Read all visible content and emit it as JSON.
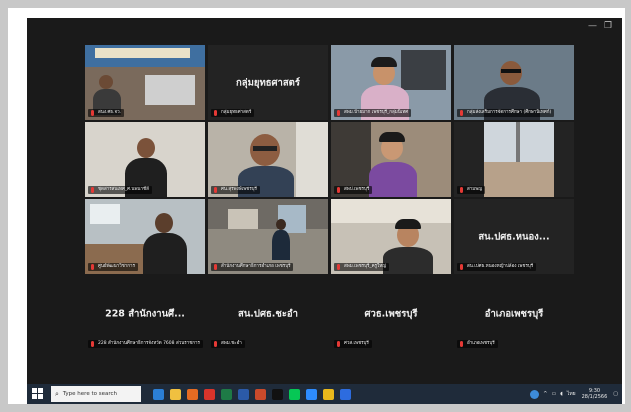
{
  "window": {
    "minimize_glyph": "—",
    "restore_glyph": "❐"
  },
  "tiles": [
    {
      "id": "t1",
      "name": "สนง.ศธ.จว.",
      "center": "",
      "active": true
    },
    {
      "id": "t2",
      "name": "กลุ่มยุทธศาสตร์",
      "center": "กลุ่มยุทธศาสตร์",
      "active": false
    },
    {
      "id": "t3",
      "name": "สพม.ป้ายมาก เพชรบุรี_กลุ่มนิเทศ",
      "center": "",
      "active": false
    },
    {
      "id": "t4",
      "name": "กลุ่มส่งเสริมการจัดการศึกษา (ศึกษานิเทศก์)",
      "center": "",
      "active": false
    },
    {
      "id": "t5",
      "name": "ชุดสารสนเทศ_ศ.นพนาชีลี",
      "center": "",
      "active": false
    },
    {
      "id": "t6",
      "name": "ศน.สุรพงษ์เพชรบุรี",
      "center": "",
      "active": false
    },
    {
      "id": "t7",
      "name": "สพป.เพชรบุรี",
      "center": "",
      "active": false
    },
    {
      "id": "t8",
      "name": "สามพญ",
      "center": "",
      "active": false
    },
    {
      "id": "t9",
      "name": "ศูนย์พัฒนาวิชาการ",
      "center": "",
      "active": false
    },
    {
      "id": "t10",
      "name": "สำนักงานศึกษาธิการอำเภอ เพชรบุรี",
      "center": "",
      "active": false
    },
    {
      "id": "t11",
      "name": "สพม.เพชรบุรี_ครูใหญ่",
      "center": "",
      "active": false
    },
    {
      "id": "t12",
      "name": "สน.เปศธ.หนองหญ้าปล้อง เพชรบุรี",
      "center": "สน.ปศธ.หนอง...",
      "active": false
    }
  ],
  "bottom_row": [
    {
      "id": "b1",
      "name": "228 สำนักงานศึกษาธิการจังหวัด 7608 ส่วนราชการ",
      "center": "228 สำนักงานศึ..."
    },
    {
      "id": "b2",
      "name": "สพม.ชะอำ",
      "center": "สน.ปศธ.ชะอำ"
    },
    {
      "id": "b3",
      "name": "ศวส.เพชรบุรี",
      "center": "ศวธ.เพชรบุรี"
    },
    {
      "id": "b4",
      "name": "อำเภอเพชรบุรี",
      "center": "อำเภอเพชรบุรี"
    }
  ],
  "taskbar": {
    "search_placeholder": "Type here to search",
    "clock_time": "9:30",
    "clock_date": "28/1/2566",
    "tray_lang": "ไทย",
    "icons": [
      {
        "name": "edge-icon",
        "color": "#2b7fd6"
      },
      {
        "name": "file-explorer-icon",
        "color": "#f0c040"
      },
      {
        "name": "firefox-icon",
        "color": "#e56b22"
      },
      {
        "name": "pdf-icon",
        "color": "#d9342b"
      },
      {
        "name": "excel-icon",
        "color": "#1e7a46"
      },
      {
        "name": "word-icon",
        "color": "#2b5aa8"
      },
      {
        "name": "powerpoint-icon",
        "color": "#c94a2b"
      },
      {
        "name": "tiktok-icon",
        "color": "#111111"
      },
      {
        "name": "line-icon",
        "color": "#06c755"
      },
      {
        "name": "zoom-app-icon",
        "color": "#2d8cff"
      },
      {
        "name": "chrome-icon",
        "color": "#e9b81c"
      },
      {
        "name": "meeting-icon",
        "color": "#2d6cdf"
      }
    ]
  },
  "colors": {
    "active_outline": "#4caf50",
    "zoom_bg": "#1a1a1a",
    "muted_mic": "#e53935"
  }
}
